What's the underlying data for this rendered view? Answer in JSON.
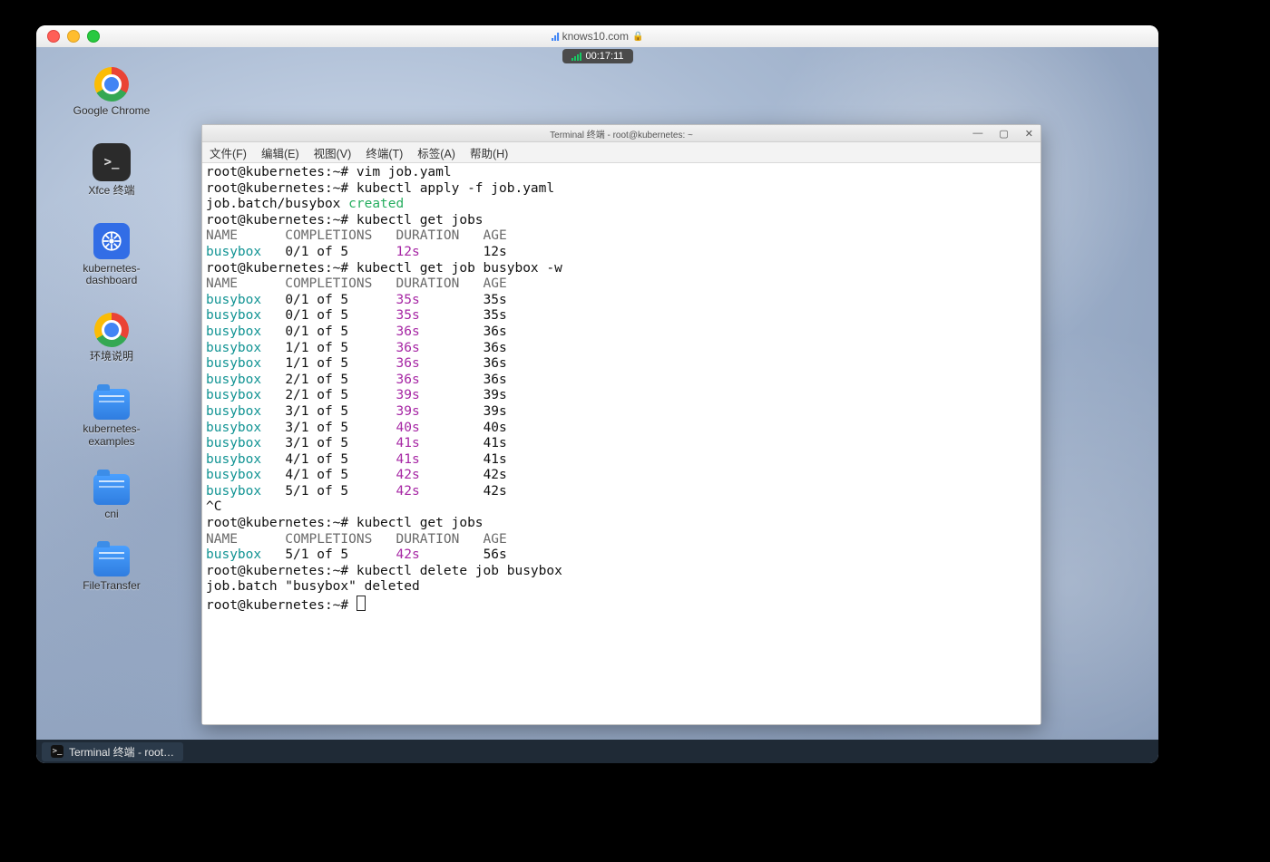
{
  "mac": {
    "address": "knows10.com",
    "timer": "00:17:11"
  },
  "desktop_icons": [
    {
      "name": "google-chrome",
      "label": "Google Chrome"
    },
    {
      "name": "xfce-terminal",
      "label": "Xfce 终端"
    },
    {
      "name": "k8s-dashboard",
      "label": "kubernetes-\ndashboard"
    },
    {
      "name": "env-readme",
      "label": "环境说明"
    },
    {
      "name": "k8s-examples",
      "label": "kubernetes-\nexamples"
    },
    {
      "name": "cni",
      "label": "cni"
    },
    {
      "name": "file-transfer",
      "label": "FileTransfer"
    }
  ],
  "taskbar": {
    "item": "Terminal 终端 - root…"
  },
  "term": {
    "title": "Terminal 终端 - root@kubernetes: ~",
    "menu": [
      "文件(F)",
      "编辑(E)",
      "视图(V)",
      "终端(T)",
      "标签(A)",
      "帮助(H)"
    ],
    "prompt": "root@kubernetes:~# ",
    "cmds": {
      "vim": "vim job.yaml",
      "apply": "kubectl apply -f job.yaml",
      "applied_prefix": "job.batch/busybox ",
      "applied_word": "created",
      "getjobs": "kubectl get jobs",
      "watch": "kubectl get job busybox -w",
      "ctrlc": "^C",
      "delete": "kubectl delete job busybox",
      "deleted": "job.batch \"busybox\" deleted"
    },
    "header": {
      "name": "NAME",
      "comp": "COMPLETIONS",
      "dur": "DURATION",
      "age": "AGE"
    },
    "row1": {
      "name": "busybox",
      "comp": "0/1 of 5",
      "dur": "12s",
      "age": "12s"
    },
    "watch_rows": [
      {
        "name": "busybox",
        "comp": "0/1 of 5",
        "dur": "35s",
        "age": "35s"
      },
      {
        "name": "busybox",
        "comp": "0/1 of 5",
        "dur": "35s",
        "age": "35s"
      },
      {
        "name": "busybox",
        "comp": "0/1 of 5",
        "dur": "36s",
        "age": "36s"
      },
      {
        "name": "busybox",
        "comp": "1/1 of 5",
        "dur": "36s",
        "age": "36s"
      },
      {
        "name": "busybox",
        "comp": "1/1 of 5",
        "dur": "36s",
        "age": "36s"
      },
      {
        "name": "busybox",
        "comp": "2/1 of 5",
        "dur": "36s",
        "age": "36s"
      },
      {
        "name": "busybox",
        "comp": "2/1 of 5",
        "dur": "39s",
        "age": "39s"
      },
      {
        "name": "busybox",
        "comp": "3/1 of 5",
        "dur": "39s",
        "age": "39s"
      },
      {
        "name": "busybox",
        "comp": "3/1 of 5",
        "dur": "40s",
        "age": "40s"
      },
      {
        "name": "busybox",
        "comp": "3/1 of 5",
        "dur": "41s",
        "age": "41s"
      },
      {
        "name": "busybox",
        "comp": "4/1 of 5",
        "dur": "41s",
        "age": "41s"
      },
      {
        "name": "busybox",
        "comp": "4/1 of 5",
        "dur": "42s",
        "age": "42s"
      },
      {
        "name": "busybox",
        "comp": "5/1 of 5",
        "dur": "42s",
        "age": "42s"
      }
    ],
    "row_final": {
      "name": "busybox",
      "comp": "5/1 of 5",
      "dur": "42s",
      "age": "56s"
    }
  }
}
